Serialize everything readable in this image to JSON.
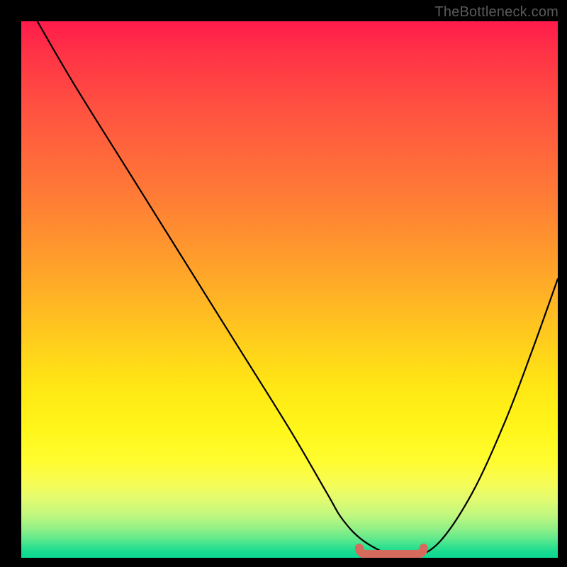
{
  "watermark": "TheBottleneck.com",
  "chart_data": {
    "type": "line",
    "title": "",
    "xlabel": "",
    "ylabel": "",
    "xlim": [
      0,
      100
    ],
    "ylim": [
      0,
      100
    ],
    "grid": false,
    "legend": false,
    "series": [
      {
        "name": "bottleneck-curve",
        "x": [
          3,
          10,
          20,
          30,
          40,
          50,
          57,
          60,
          64,
          70,
          73,
          78,
          84,
          90,
          95,
          100
        ],
        "values": [
          100,
          88,
          72,
          56,
          40,
          24,
          12,
          7,
          3,
          0,
          0,
          3,
          12,
          25,
          38,
          52
        ]
      }
    ],
    "annotations": [
      {
        "name": "optimal-range",
        "x_start": 63,
        "x_end": 75,
        "value": 0
      }
    ],
    "gradient_scale": {
      "description": "vertical severity gradient (red=high bottleneck, green=none)",
      "stops": [
        {
          "pos": 0.0,
          "color": "#ff1b4b"
        },
        {
          "pos": 0.5,
          "color": "#ffc81e"
        },
        {
          "pos": 0.82,
          "color": "#fffc2f"
        },
        {
          "pos": 1.0,
          "color": "#0cd992"
        }
      ]
    }
  }
}
